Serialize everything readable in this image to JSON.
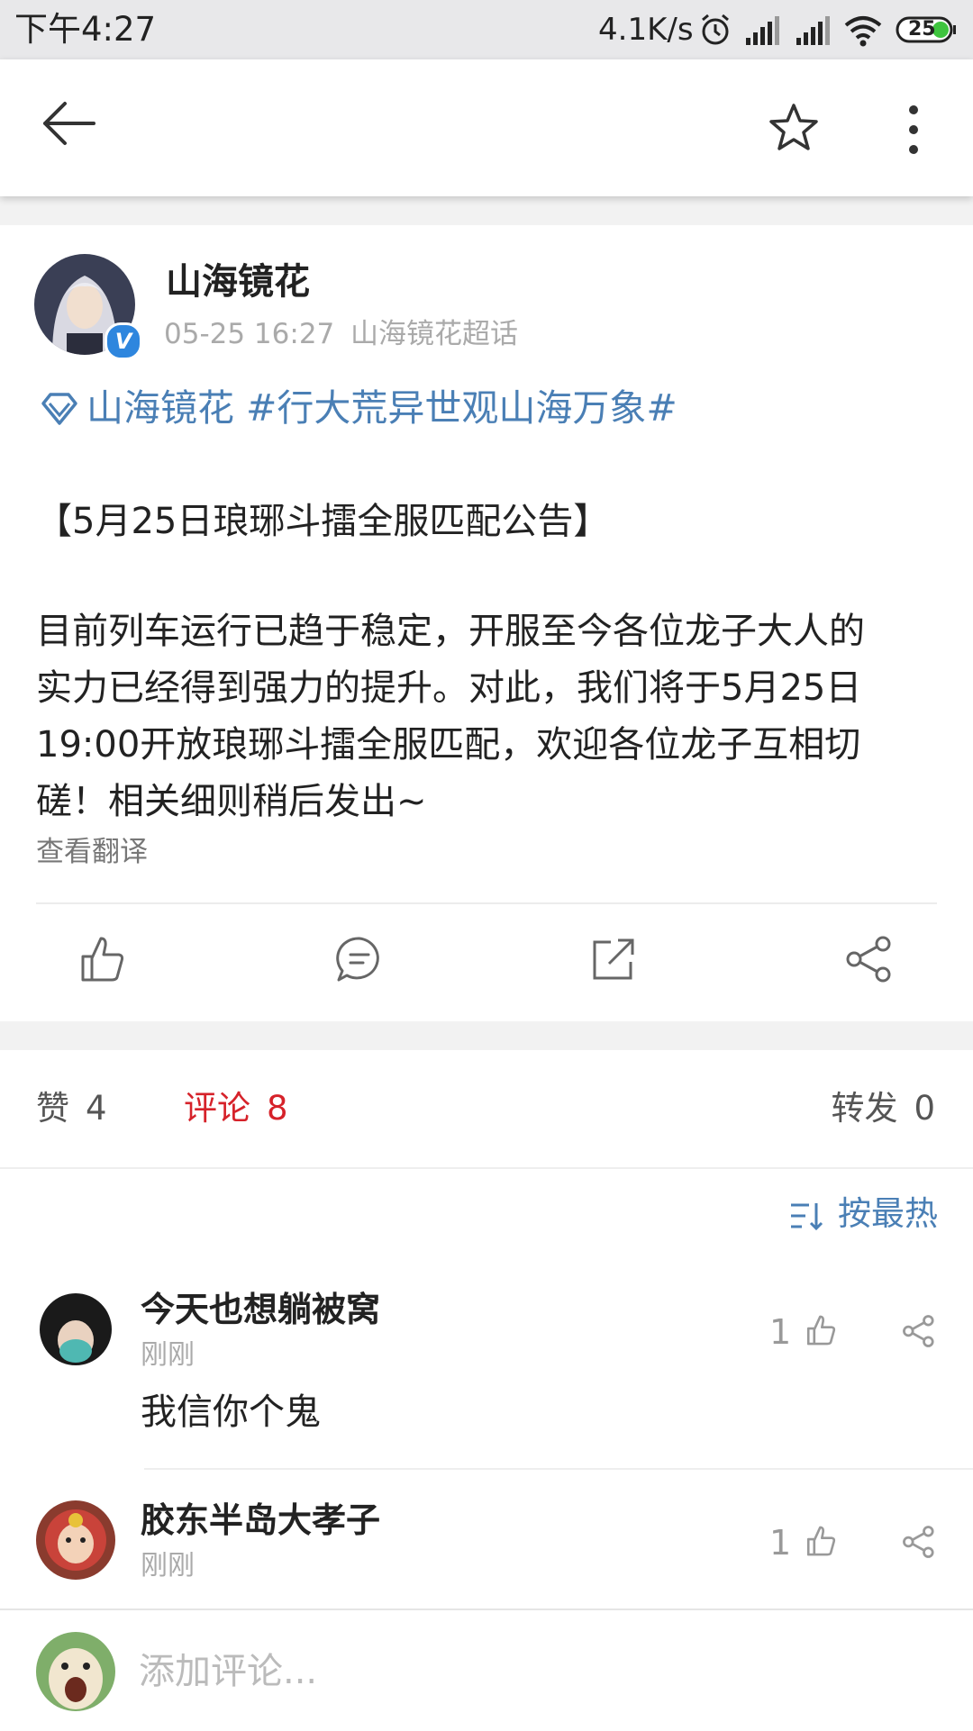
{
  "status_bar": {
    "time": "下午4:27",
    "network_speed": "4.1K/s",
    "battery": "25",
    "icons": [
      "alarm-icon",
      "signal-icon",
      "signal-icon",
      "wifi-icon",
      "battery-icon"
    ]
  },
  "toolbar": {
    "icons": [
      "back-arrow-icon",
      "star-icon",
      "more-vertical-icon"
    ]
  },
  "post": {
    "author": "山海镜花",
    "time": "05-25 16:27",
    "source": "山海镜花超话",
    "verified_badge": "V",
    "topic_line": "山海镜花 #行大荒异世观山海万象#",
    "title": "【5月25日琅琊斗擂全服匹配公告】",
    "body_lines": [
      "目前列车运行已趋于稳定，开服至今各位龙子大人的",
      "实力已经得到强力的提升。对此，我们将于5月25日",
      "19:00开放琅琊斗擂全服匹配，欢迎各位龙子互相切",
      "磋！相关细则稍后发出~"
    ],
    "translate_link": "查看翻译",
    "actions": [
      "thumbs-up-icon",
      "comment-icon",
      "repost-icon",
      "share-icon"
    ]
  },
  "stats": {
    "likes_label": "赞",
    "likes_count": "4",
    "comments_label": "评论",
    "comments_count": "8",
    "reposts_label": "转发",
    "reposts_count": "0"
  },
  "sort": {
    "label": "按最热"
  },
  "comments": [
    {
      "name": "今天也想躺被窝",
      "time": "刚刚",
      "text": "我信你个鬼",
      "likes": "1"
    },
    {
      "name": "胶东半岛大孝子",
      "time": "刚刚",
      "text": "",
      "likes": "1"
    }
  ],
  "comment_box": {
    "placeholder": "添加评论..."
  },
  "colors": {
    "accent_blue": "#4a7fb5",
    "active_red": "#d6222a",
    "verified_blue": "#2e86de"
  }
}
